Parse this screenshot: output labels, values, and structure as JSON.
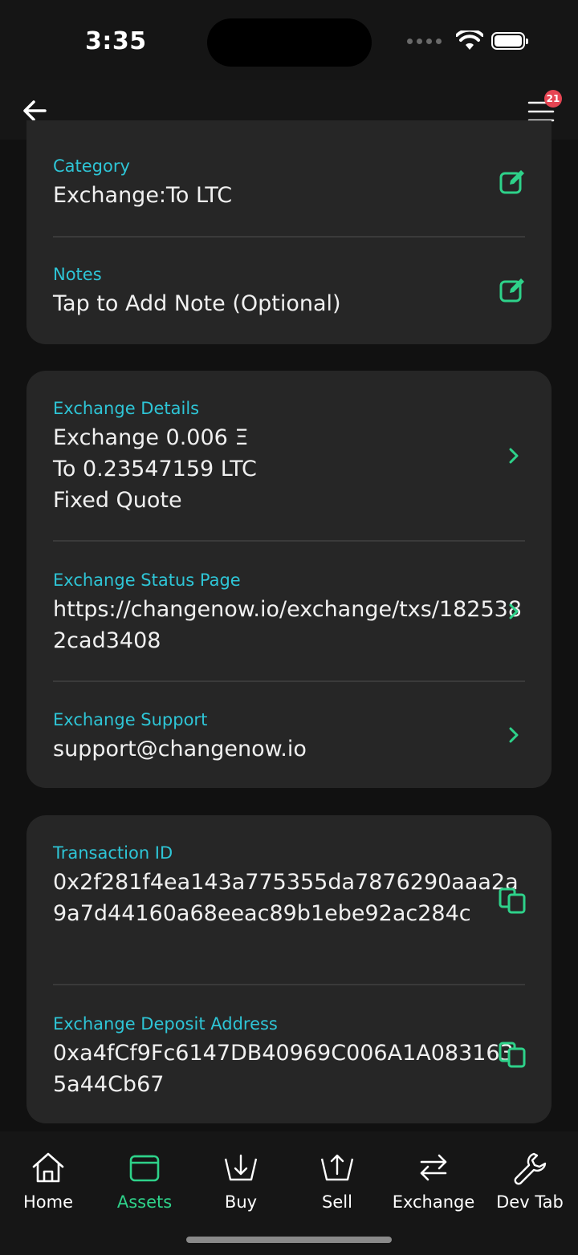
{
  "status": {
    "time": "3:35"
  },
  "nav": {
    "notification_count": "21"
  },
  "card1": {
    "category_label": "Category",
    "category_value": "Exchange:To LTC",
    "notes_label": "Notes",
    "notes_value": "Tap to Add Note (Optional)"
  },
  "card2": {
    "details_label": "Exchange Details",
    "details_line1": "Exchange 0.006 Ξ",
    "details_line2": "To 0.23547159 LTC",
    "details_line3": "Fixed Quote",
    "status_label": "Exchange Status Page",
    "status_value": "https://changenow.io/exchange/txs/1825382cad3408",
    "support_label": "Exchange Support",
    "support_value": "support@changenow.io"
  },
  "card3": {
    "txid_label": "Transaction ID",
    "txid_value": "0x2f281f4ea143a775355da7876290aaa2a9a7d44160a68eeac89b1ebe92ac284c",
    "deposit_label": "Exchange Deposit Address",
    "deposit_value": "0xa4fCf9Fc6147DB40969C006A1A0831635a44Cb67"
  },
  "tabs": [
    {
      "label": "Home",
      "icon": "home-icon"
    },
    {
      "label": "Assets",
      "icon": "wallet-icon",
      "active": true
    },
    {
      "label": "Buy",
      "icon": "buy-icon"
    },
    {
      "label": "Sell",
      "icon": "sell-icon"
    },
    {
      "label": "Exchange",
      "icon": "exchange-icon"
    },
    {
      "label": "Dev Tab",
      "icon": "wrench-icon"
    }
  ],
  "colors": {
    "accent_label": "#2ec5d6",
    "accent_icon": "#2ed28a",
    "badge": "#e64553",
    "card": "#262626"
  }
}
